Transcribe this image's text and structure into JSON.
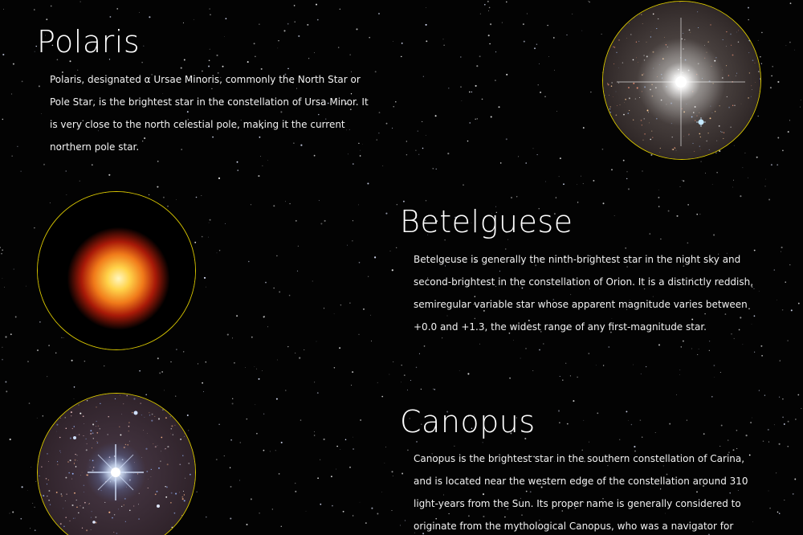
{
  "stars": [
    {
      "name": "Polaris",
      "description": "Polaris, designated α Ursae Minoris, commonly the North Star or Pole Star, is the brightest star in the constellation of Ursa Minor. It is very close to the north celestial pole, making it the current northern pole star."
    },
    {
      "name": "Betelguese",
      "description": "Betelgeuse is generally the ninth-brightest star in the night sky and second-brightest in the constellation of Orion. It is a distinctly reddish, semiregular variable star whose apparent magnitude varies between +0.0 and +1.3, the widest range of any first-magnitude star."
    },
    {
      "name": "Canopus",
      "description": "Canopus is the brightest star in the southern constellation of Carina, and is located near the western edge of the constellation around 310 light-years from the Sun. Its proper name is generally considered to originate from the mythological Canopus, who was a navigator for Menelaus, king of Sparta."
    }
  ],
  "colors": {
    "background": "#030303",
    "image_border": "#d8c600",
    "text": "#ffffff"
  }
}
